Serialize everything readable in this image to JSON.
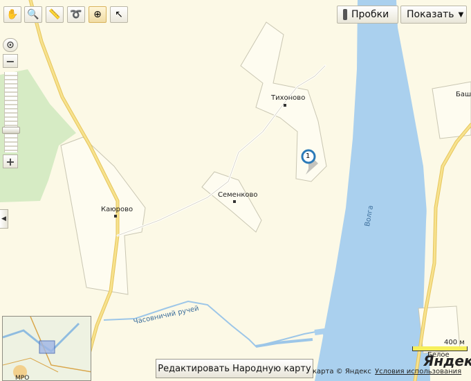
{
  "toolbar": {
    "tools": [
      {
        "name": "hand-tool-icon",
        "glyph": "✋"
      },
      {
        "name": "magnifier-tool-icon",
        "glyph": "🔍"
      },
      {
        "name": "ruler-tool-icon",
        "glyph": "📏"
      },
      {
        "name": "route-tool-icon",
        "glyph": "➰"
      },
      {
        "name": "add-object-tool-icon",
        "glyph": "⊕"
      },
      {
        "name": "select-tool-icon",
        "glyph": "↖"
      }
    ],
    "traffic_label": "Пробки",
    "show_label": "Показать",
    "show_arrow": "▼"
  },
  "zoom": {
    "in": "+",
    "out": "−"
  },
  "places": {
    "kayurovo": "Каюрово",
    "semenkovo": "Семенково",
    "tikhonovo": "Тихоново",
    "basha": "Баша",
    "beloe": "Белое",
    "chasovnichiy": "Часовничий ручей",
    "volga": "Волга",
    "mro": "МРО"
  },
  "marker": {
    "number": "1"
  },
  "edit_button": "Редактировать Народную карту",
  "copyright": "карта © Яндекс",
  "terms": "Условия использования",
  "scale": "400 м",
  "logo": "Яндекс",
  "colors": {
    "land": "#fcf9e6",
    "water": "#aad0ee",
    "forest": "#d6ebc4",
    "road": "#f3d678",
    "border": "#c9c6b2"
  }
}
